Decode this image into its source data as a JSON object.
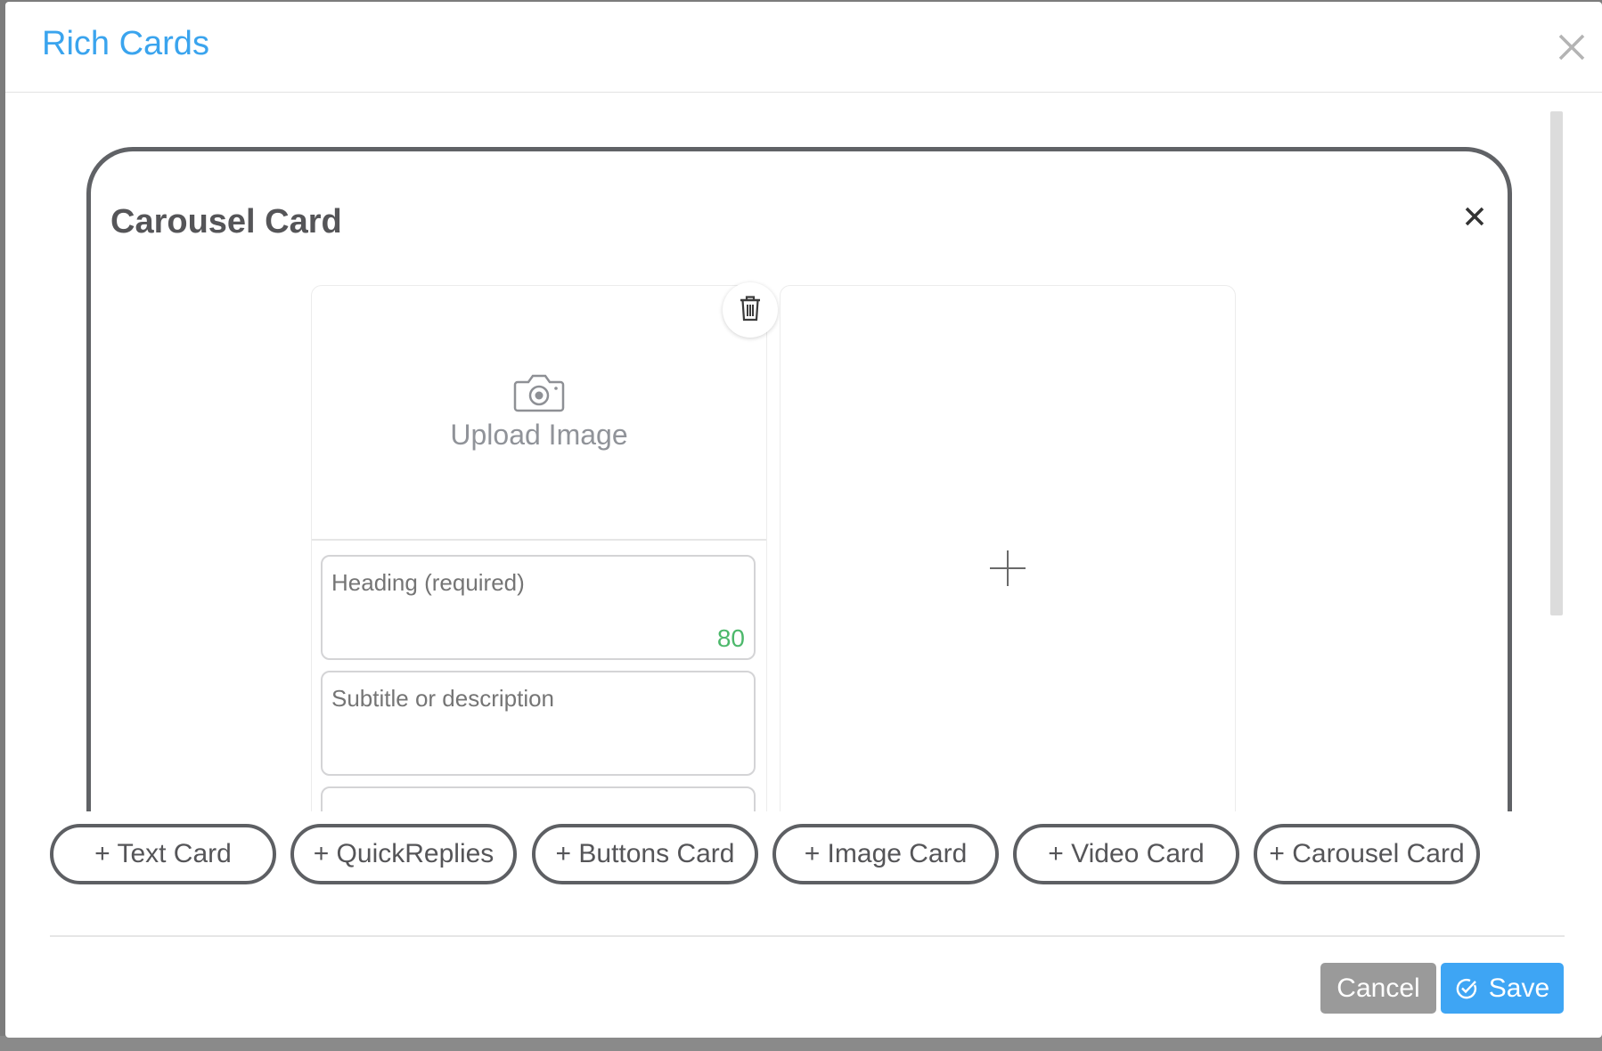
{
  "modal": {
    "title": "Rich Cards",
    "close_icon": "close-icon"
  },
  "phone": {
    "title": "Carousel Card",
    "close_icon": "close-icon"
  },
  "cards": [
    {
      "upload_label": "Upload Image",
      "upload_icon": "camera-icon",
      "delete_icon": "trash-icon",
      "heading_placeholder": "Heading (required)",
      "heading_counter": "80",
      "subtitle_placeholder": "Subtitle or description"
    },
    {
      "add_icon": "plus-icon"
    }
  ],
  "actions": [
    {
      "label": "+ Text Card"
    },
    {
      "label": "+ QuickReplies"
    },
    {
      "label": "+ Buttons Card"
    },
    {
      "label": "+ Image Card"
    },
    {
      "label": "+ Video Card"
    },
    {
      "label": "+ Carousel Card"
    }
  ],
  "footer": {
    "cancel_label": "Cancel",
    "save_label": "Save",
    "save_icon": "check-circle-icon"
  },
  "colors": {
    "accent": "#3ea5f4",
    "title": "#3aa4ee",
    "counter": "#4cb86b",
    "cancel": "#9a9a9a",
    "border": "#5d5f63"
  }
}
